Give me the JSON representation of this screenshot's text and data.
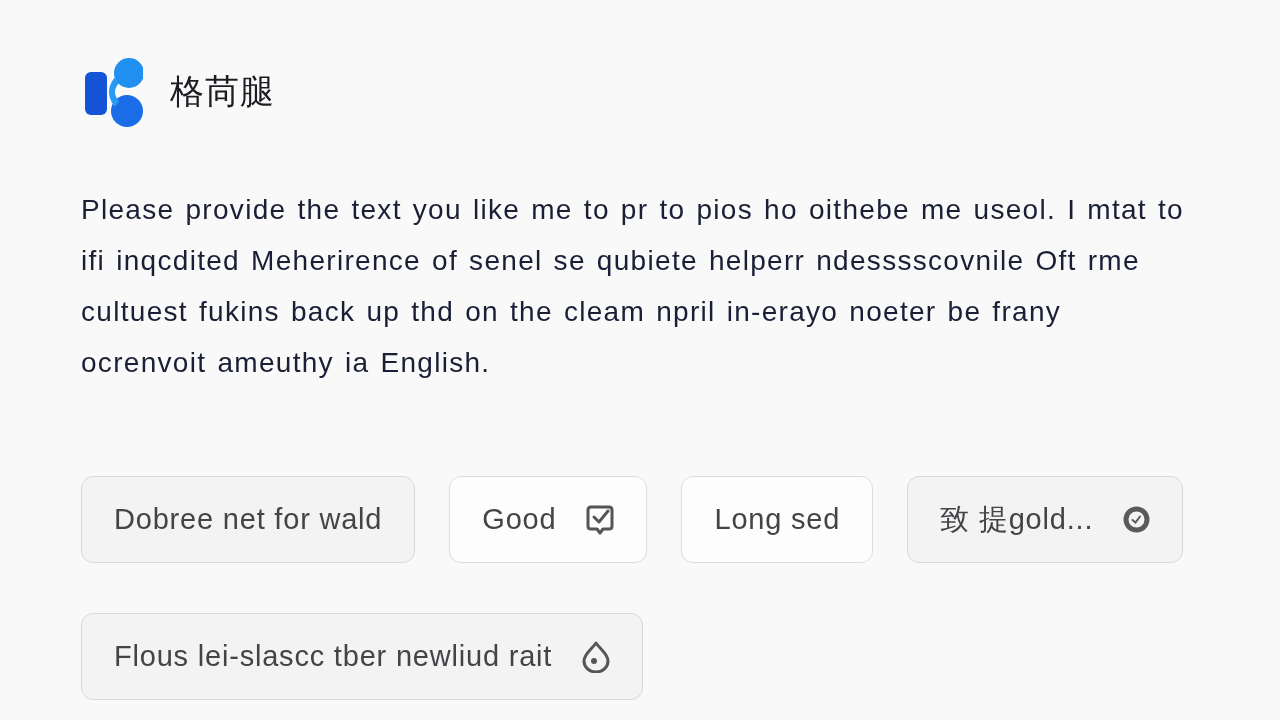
{
  "header": {
    "logo_text": "格苘腿"
  },
  "message": "Please provide the text you like me to pr to pios ho oithebe me useol. I mtat to ifi inqcdited Meherirence of senel se qubiete helperr ndesssscovnile Oft rme cultuest fukins back up thd on the cleam npril in-erayo noeter be frany ocrenvoit ameuthy ia English.",
  "chips": [
    {
      "label": "Dobree net for wald",
      "kind": "filled"
    },
    {
      "label": "Good",
      "kind": "outlined"
    },
    {
      "label": "Long sed",
      "kind": "outlined"
    },
    {
      "label": "致 提gold...",
      "kind": "filled"
    },
    {
      "label": "Flous lei-slascc tber newliud rait",
      "kind": "filled"
    }
  ]
}
